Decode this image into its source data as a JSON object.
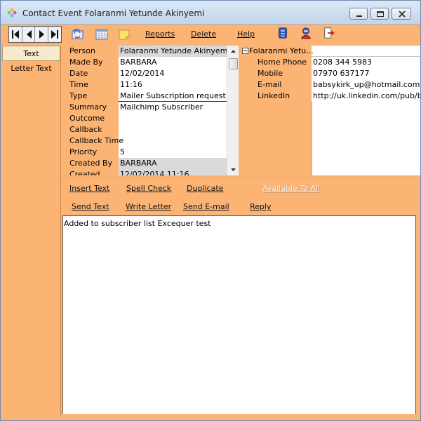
{
  "window": {
    "title": "Contact Event Folaranmi Yetunde Akinyemi",
    "controls": [
      "minimize",
      "maximize",
      "close"
    ]
  },
  "toolbar": {
    "nav_buttons": [
      "first-record",
      "previous-record",
      "next-record",
      "last-record"
    ],
    "icons": [
      "refresh-contacts-icon",
      "calendar-grid-icon",
      "note-icon"
    ],
    "links": {
      "reports": "Reports",
      "delete": "Delete",
      "help": "Help"
    },
    "right_icons": [
      "database-icon",
      "user-icon",
      "exit-icon"
    ]
  },
  "tabs": [
    {
      "label": "Text",
      "active": true
    },
    {
      "label": "Letter Text",
      "active": false
    }
  ],
  "properties": [
    {
      "label": "Person",
      "value": "Folaranmi Yetunde Akinyemi",
      "highlight": true
    },
    {
      "label": "Made By",
      "value": "BARBARA",
      "highlight": false
    },
    {
      "label": "Date",
      "value": "12/02/2014",
      "highlight": false
    },
    {
      "label": "Time",
      "value": "11:16",
      "highlight": false
    },
    {
      "label": "Type",
      "value": "Mailer Subscription request sent",
      "highlight": false
    },
    {
      "label": "Summary",
      "value": "Mailchimp Subscriber",
      "highlight": false
    },
    {
      "label": "Outcome",
      "value": "",
      "highlight": false
    },
    {
      "label": "Callback",
      "value": "",
      "highlight": false
    },
    {
      "label": "Callback Time",
      "value": "",
      "highlight": false
    },
    {
      "label": "Priority",
      "value": "5",
      "highlight": false
    },
    {
      "label": "Created By",
      "value": "BARBARA",
      "highlight": true
    },
    {
      "label": "Created",
      "value": "12/02/2014 11:16",
      "highlight": true
    }
  ],
  "contact": {
    "name": "Folaranmi Yetu...",
    "fields": [
      {
        "label": "Home Phone",
        "value": "0208 344 5983"
      },
      {
        "label": "Mobile",
        "value": "07970 637177"
      },
      {
        "label": "E-mail",
        "value": "babsykirk_up@hotmail.com"
      },
      {
        "label": "LinkedIn",
        "value": "http://uk.linkedin.com/pub/ba"
      }
    ]
  },
  "actions": {
    "insert_text": "Insert Text",
    "spell_check": "Spell Check",
    "duplicate": "Duplicate",
    "available_to_all": "Available To All",
    "send_text": "Send Text",
    "write_letter": "Write Letter",
    "send_email": "Send E-mail",
    "reply": "Reply"
  },
  "note": {
    "text": "Added to subscriber list Excequer test"
  },
  "colors": {
    "panel": "#fcb475",
    "titlebar": "#c3d5ea",
    "grey_value": "#d9d9d9"
  }
}
